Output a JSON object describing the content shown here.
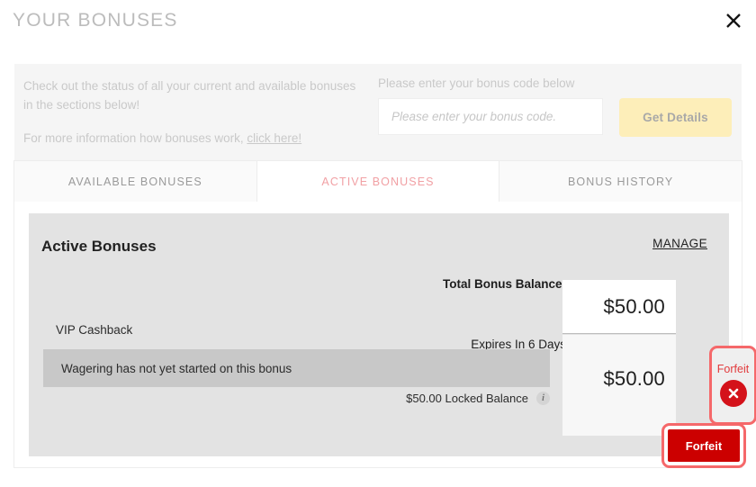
{
  "header": {
    "title": "YOUR BONUSES",
    "close_icon": "close-icon"
  },
  "info": {
    "paragraph1": "Check out the status of all your current and available bonuses in the sections below!",
    "paragraph2_prefix": "For more information how bonuses work, ",
    "link_text": "click here!"
  },
  "bonus_code": {
    "label": "Please enter your bonus code below",
    "input_value": "",
    "input_placeholder": "Please enter your bonus code.",
    "button_label": "Get Details"
  },
  "tabs": [
    {
      "label": "AVAILABLE BONUSES",
      "active": false
    },
    {
      "label": "ACTIVE BONUSES",
      "active": true
    },
    {
      "label": "BONUS HISTORY",
      "active": false
    }
  ],
  "panel": {
    "title": "Active Bonuses",
    "manage_label": "MANAGE",
    "total_balance_label": "Total Bonus Balance:",
    "total_balance_value": "$50.00",
    "expires_label": "Expires In 6 Days",
    "bonus_name": "VIP Cashback",
    "wagering_text": "Wagering has not yet started on this bonus",
    "bonus_balance_value": "$50.00",
    "locked_balance_text": "$50.00 Locked Balance",
    "info_icon_glyph": "i",
    "forfeit_icon_label": "Forfeit",
    "forfeit_button_label": "Forfeit"
  },
  "colors": {
    "accent_red": "#cc0000",
    "highlight_red": "#f5686a",
    "active_tab_text": "#f1a0a4",
    "button_yellow": "#fdeeb9",
    "panel_gray": "#e3e3e3",
    "wagering_gray": "#c8c8c8"
  }
}
